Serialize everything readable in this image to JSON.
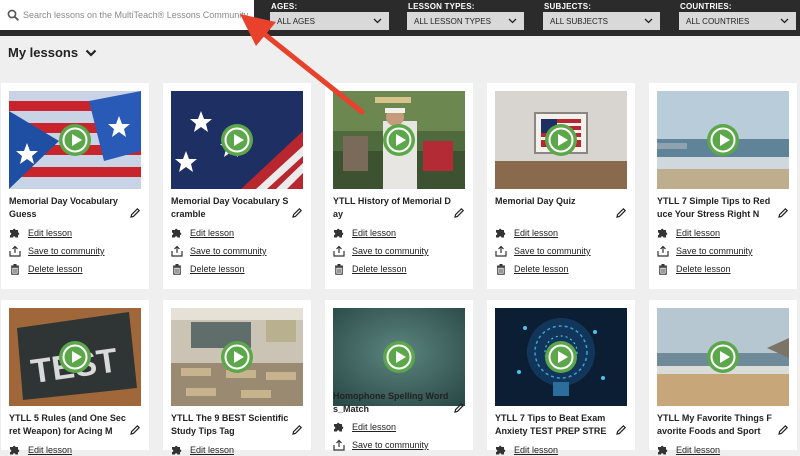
{
  "search": {
    "placeholder": "Search lessons on the MultiTeach® Lessons Community"
  },
  "filters": [
    {
      "label": "AGES:",
      "value": "ALL AGES"
    },
    {
      "label": "LESSON TYPES:",
      "value": "ALL LESSON TYPES"
    },
    {
      "label": "SUBJECTS:",
      "value": "ALL SUBJECTS"
    },
    {
      "label": "COUNTRIES:",
      "value": "ALL COUNTRIES"
    }
  ],
  "heading": "My lessons",
  "actions": {
    "edit": "Edit lesson",
    "save": "Save to community",
    "delete": "Delete lesson"
  },
  "colors": {
    "accent_play": "#5ca74a",
    "topbar": "#2b2b2b",
    "arrow": "#e8412c"
  },
  "lessons": [
    {
      "title": "Memorial Day Vocabulary Guess"
    },
    {
      "title": "Memorial Day Vocabulary Scramble"
    },
    {
      "title": "YTLL History of Memorial Day"
    },
    {
      "title": "Memorial Day Quiz"
    },
    {
      "title": "YTLL 7 Simple Tips to Reduce Your Stress Right N"
    },
    {
      "title": "YTLL 5 Rules (and One Secret Weapon) for Acing M"
    },
    {
      "title": "YTLL The 9 BEST Scientific Study Tips Tag"
    },
    {
      "title": "Homophone Spelling Words_Match"
    },
    {
      "title": "YTLL 7 Tips to Beat Exam Anxiety TEST PREP STRE"
    },
    {
      "title": "YTLL My Favorite Things Favorite Foods and Sport"
    }
  ]
}
